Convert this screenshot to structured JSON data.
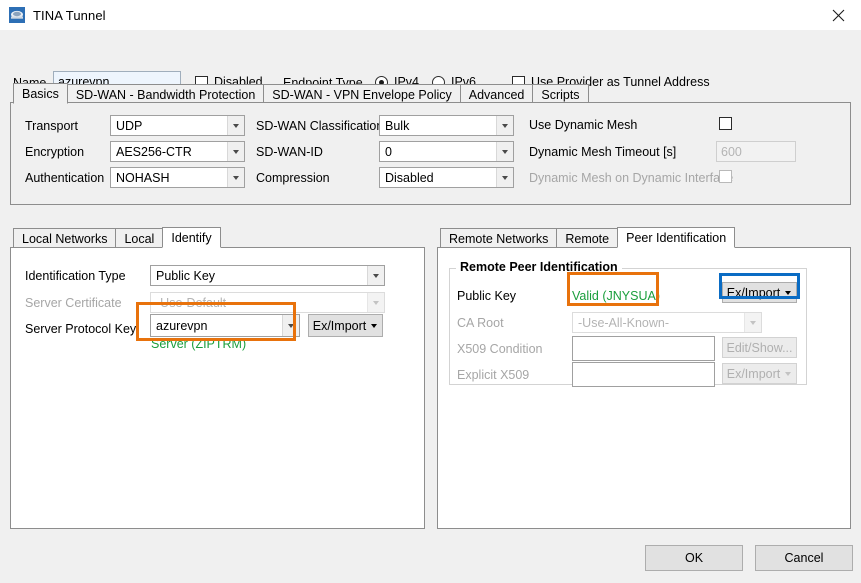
{
  "window": {
    "title": "TINA Tunnel",
    "icon": "tina-tunnel-icon",
    "close_icon": "close-icon"
  },
  "header": {
    "name_label": "Name",
    "name_value": "azurevpn",
    "disabled_label": "Disabled",
    "disabled_checked": false,
    "endpoint_type_label": "Endpoint Type",
    "ipv4_label": "IPv4",
    "ipv6_label": "IPv6",
    "endpoint_selected": "IPv4",
    "use_provider_label": "Use Provider as Tunnel Address",
    "use_provider_checked": false
  },
  "main_tabs": {
    "selected": "Basics",
    "items": [
      {
        "label": "Basics"
      },
      {
        "label": "SD-WAN - Bandwidth Protection"
      },
      {
        "label": "SD-WAN - VPN Envelope Policy"
      },
      {
        "label": "Advanced"
      },
      {
        "label": "Scripts"
      }
    ]
  },
  "basics": {
    "left_fields": [
      {
        "label": "Transport",
        "value": "UDP"
      },
      {
        "label": "Encryption",
        "value": "AES256-CTR"
      },
      {
        "label": "Authentication",
        "value": "NOHASH"
      }
    ],
    "mid_fields": [
      {
        "label": "SD-WAN Classification",
        "value": "Bulk"
      },
      {
        "label": "SD-WAN-ID",
        "value": "0"
      },
      {
        "label": "Compression",
        "value": "Disabled"
      }
    ],
    "mesh": {
      "use_dynamic_mesh_label": "Use Dynamic Mesh",
      "use_dynamic_mesh_checked": false,
      "timeout_label": "Dynamic Mesh Timeout [s]",
      "timeout_value": "600",
      "timeout_enabled": false,
      "dyn_interface_label": "Dynamic Mesh on Dynamic Interface",
      "dyn_interface_checked": false,
      "dyn_interface_enabled": false
    }
  },
  "left_panel": {
    "tabs": {
      "selected": "Identify",
      "items": [
        {
          "label": "Local Networks"
        },
        {
          "label": "Local"
        },
        {
          "label": "Identify"
        }
      ]
    },
    "fields": {
      "identification_type_label": "Identification Type",
      "identification_type_value": "Public Key",
      "server_certificate_label": "Server Certificate",
      "server_certificate_value": "-Use-Default-",
      "server_protocol_key_label": "Server Protocol Key",
      "server_protocol_key_value": "azurevpn",
      "server_protocol_key_status": "Server (ZIPTRM)",
      "eximport_label": "Ex/Import"
    }
  },
  "right_panel": {
    "tabs": {
      "selected": "Peer Identification",
      "items": [
        {
          "label": "Remote Networks"
        },
        {
          "label": "Remote"
        },
        {
          "label": "Peer Identification"
        }
      ]
    },
    "group_title": "Remote Peer Identification",
    "fields": {
      "public_key_label": "Public Key",
      "public_key_status": "Valid (JNYSUA)",
      "public_key_eximport_label": "Ex/Import",
      "ca_root_label": "CA Root",
      "ca_root_value": "-Use-All-Known-",
      "x509_condition_label": "X509 Condition",
      "x509_condition_value": "",
      "x509_edit_label": "Edit/Show...",
      "explicit_x509_label": "Explicit X509",
      "explicit_x509_value": "",
      "explicit_x509_eximport_label": "Ex/Import"
    }
  },
  "footer": {
    "ok_label": "OK",
    "cancel_label": "Cancel"
  },
  "annotations": {
    "highlight_color_orange": "#e8720c",
    "highlight_color_blue": "#0a6cc4",
    "status_green": "#1a9e3c"
  }
}
